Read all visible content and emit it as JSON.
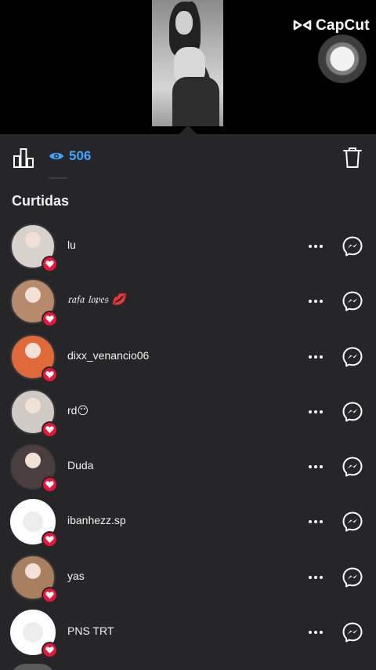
{
  "overlay": {
    "brand": "CapCut"
  },
  "toolbar": {
    "view_count": "506"
  },
  "section": {
    "title": "Curtidas"
  },
  "likes": [
    {
      "username": "lu",
      "avatar_color": "#d8d2cc"
    },
    {
      "username": "𝔯𝔞𝔣𝔞 𝔩𝔬𝔭𝔢𝔰 💋",
      "avatar_color": "#b78a6b"
    },
    {
      "username": "dixx_venancio06",
      "avatar_color": "#e0693a"
    },
    {
      "username": "rd😶",
      "avatar_color": "#cfcac5"
    },
    {
      "username": "Duda",
      "avatar_color": "#4a3f3e"
    },
    {
      "username": "ibanhezz.sp",
      "avatar_color": "default"
    },
    {
      "username": "yas",
      "avatar_color": "#a8805f"
    },
    {
      "username": "PNS TRT ",
      "avatar_color": "default"
    }
  ],
  "colors": {
    "sheet": "#262628",
    "accent": "#3ea6ff",
    "like_badge": "#e8173a"
  }
}
